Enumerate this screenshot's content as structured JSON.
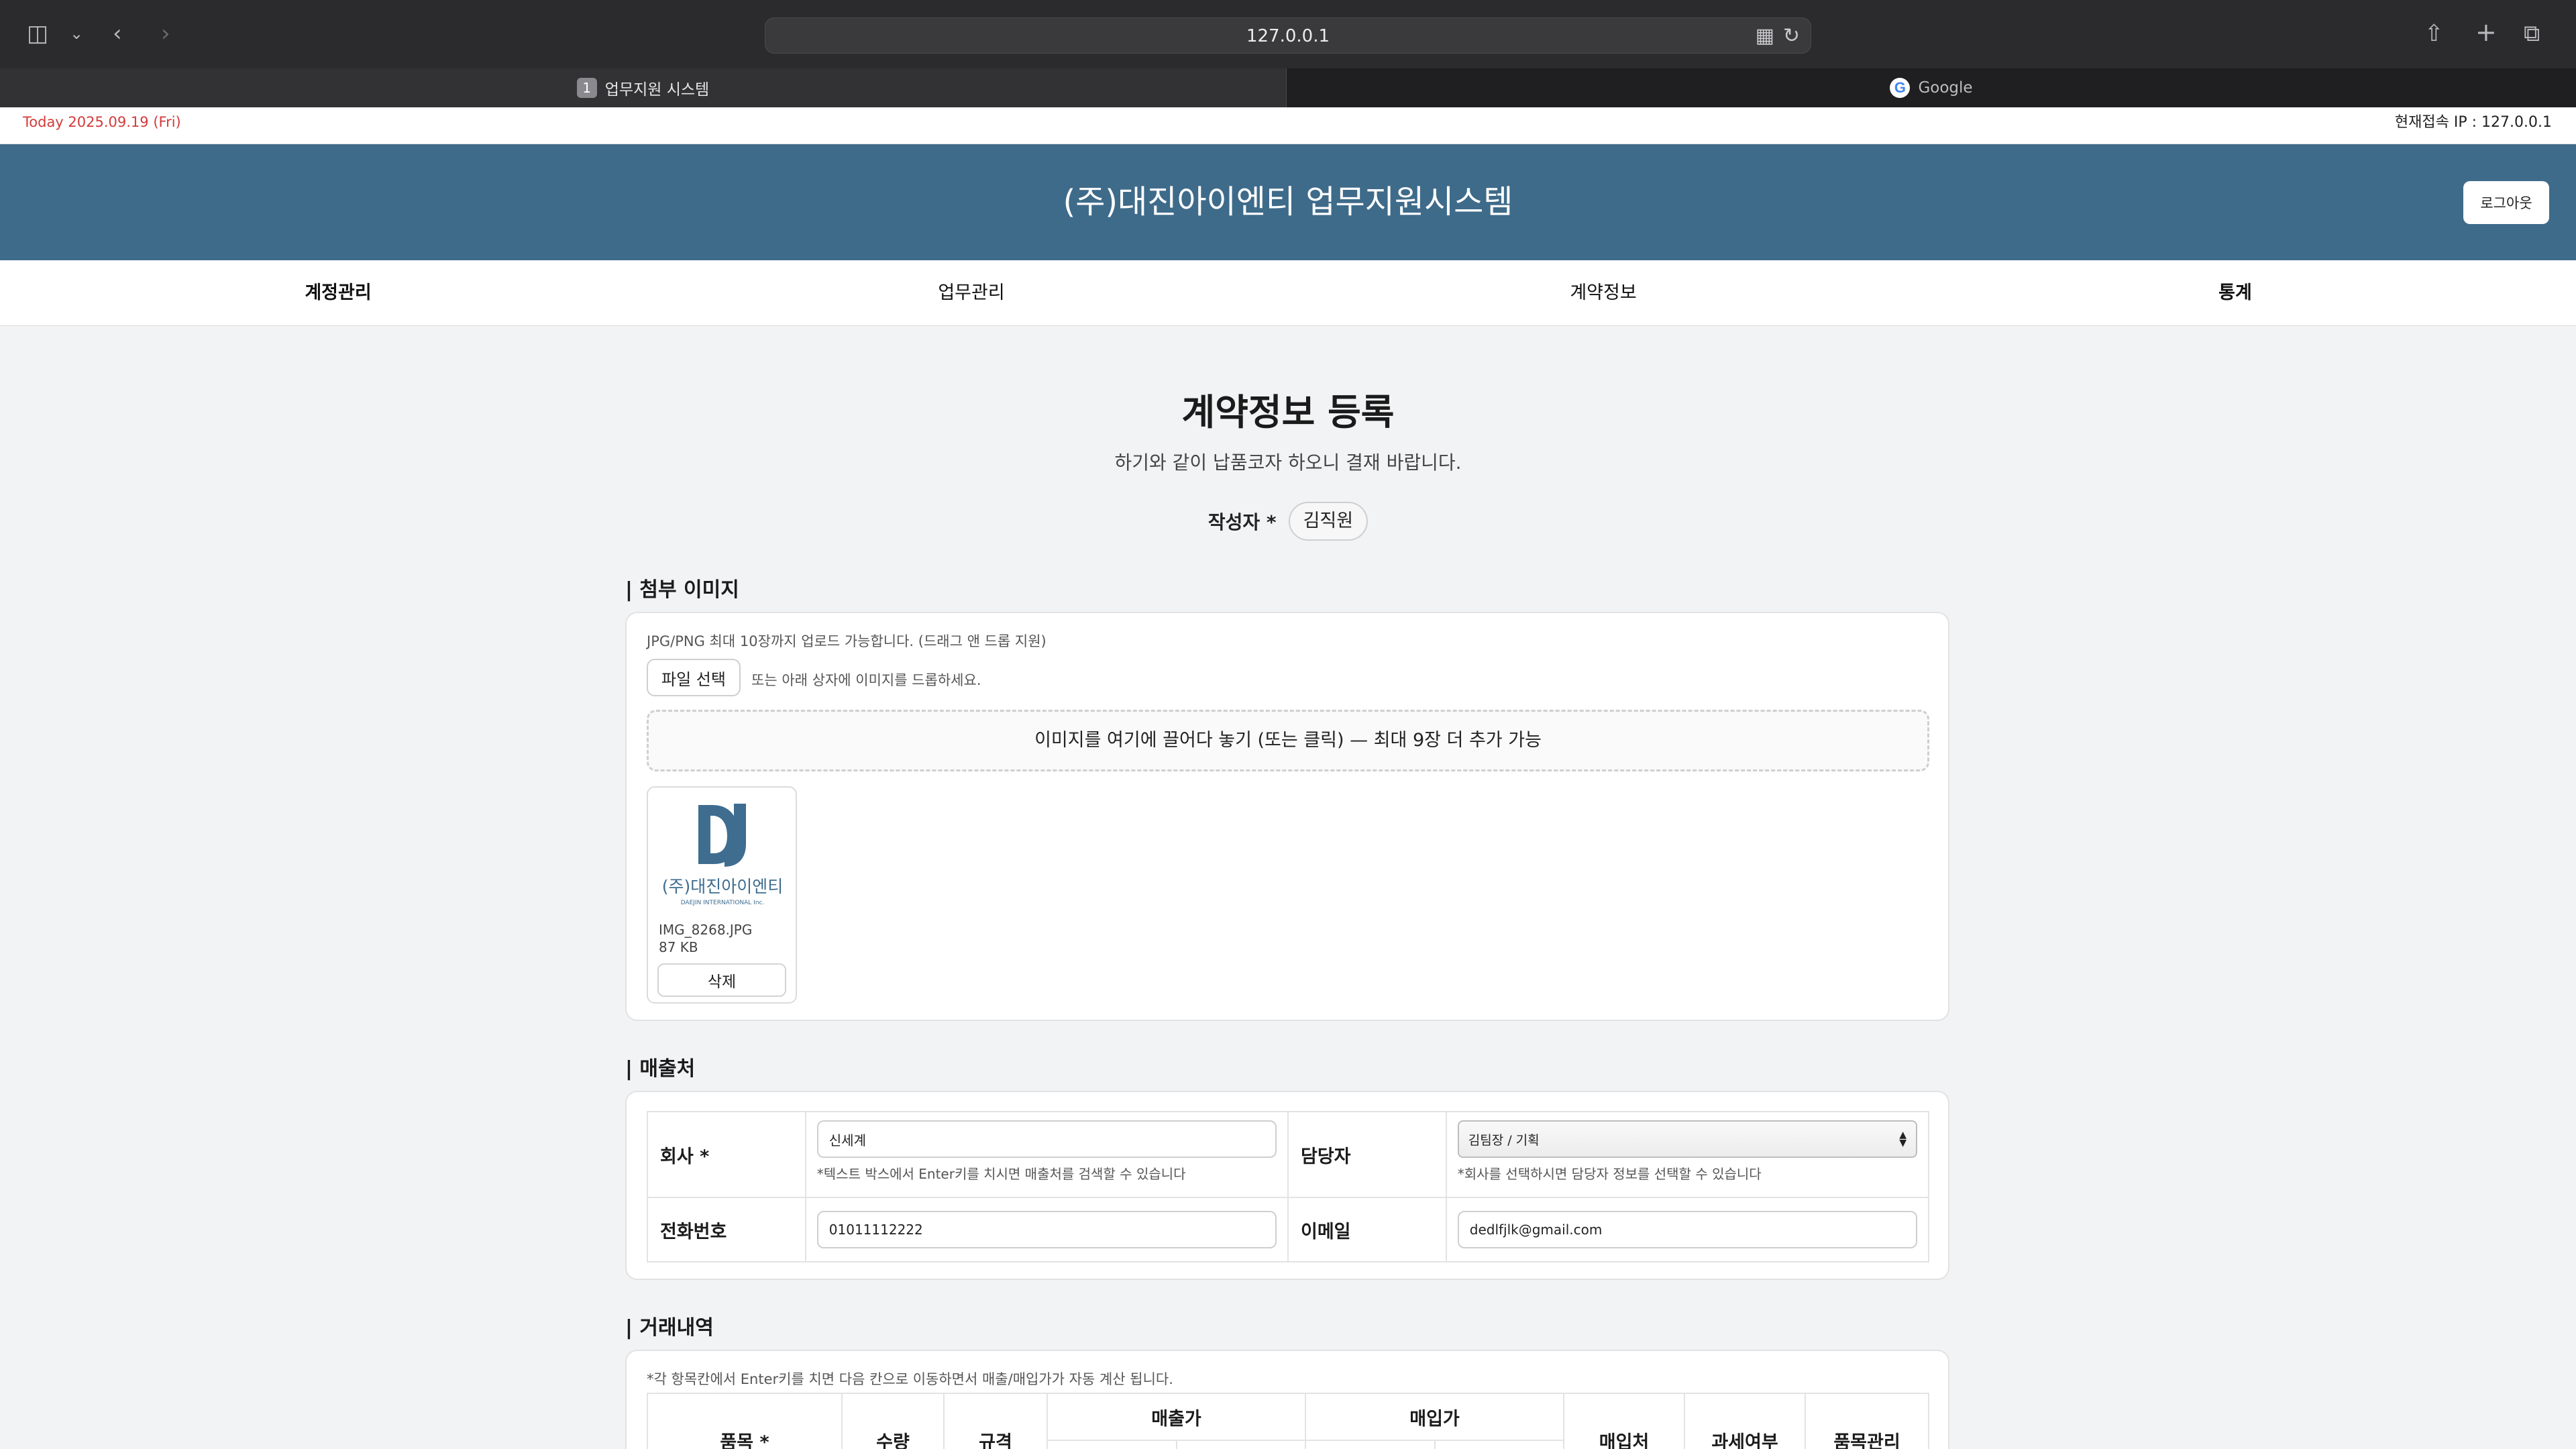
{
  "browser": {
    "url": "127.0.0.1",
    "tabs": [
      {
        "label": "업무지원 시스템",
        "badge": "1",
        "active": true
      },
      {
        "label": "Google",
        "active": false
      }
    ]
  },
  "info_bar": {
    "today": "Today 2025.09.19 (Fri)",
    "ip": "현재접속 IP : 127.0.0.1"
  },
  "header": {
    "title": "(주)대진아이엔티 업무지원시스템",
    "logout_label": "로그아웃"
  },
  "nav": {
    "items": [
      {
        "label": "계정관리",
        "bold": true
      },
      {
        "label": "업무관리",
        "bold": false
      },
      {
        "label": "계약정보",
        "bold": false
      },
      {
        "label": "통계",
        "bold": true
      }
    ]
  },
  "page": {
    "title": "계약정보 등록",
    "subtitle": "하기와 같이 납품코자 하오니 결재 바랍니다.",
    "author_label": "작성자 *",
    "author_value": "김직원"
  },
  "attachments": {
    "section_title": "| 첨부 이미지",
    "limit_hint": "JPG/PNG 최대 10장까지 업로드 가능합니다. (드래그 앤 드롭 지원)",
    "file_button_label": "파일 선택",
    "file_hint": "또는 아래 상자에 이미지를 드롭하세요.",
    "dropzone_text": "이미지를 여기에 끌어다 놓기 (또는 클릭) — 최대 9장 더 추가 가능",
    "files": [
      {
        "name": "IMG_8268.JPG",
        "size": "87 KB",
        "delete_label": "삭제",
        "logo_text": "(주)대진아이엔티",
        "logo_subtext": "DAEJIN INTERNATIONAL Inc.",
        "logo_color": "#3e6d90"
      }
    ]
  },
  "seller": {
    "section_title": "| 매출처",
    "company_label": "회사 *",
    "company_value": "신세계",
    "company_hint": "*텍스트 박스에서 Enter키를 치시면 매출처를 검색할 수 있습니다",
    "manager_label": "담당자",
    "manager_value": "김팀장 / 기획",
    "manager_hint": "*회사를 선택하시면 담당자 정보를 선택할 수 있습니다",
    "phone_label": "전화번호",
    "phone_value": "01011112222",
    "email_label": "이메일",
    "email_value": "dedlfjlk@gmail.com"
  },
  "trades": {
    "section_title": "| 거래내역",
    "hint": "*각 항목칸에서 Enter키를 치면 다음 칸으로 이동하면서 매출/매입가가 자동 계산 됩니다.",
    "headers": {
      "item": "품목 *",
      "qty": "수량",
      "spec": "규격",
      "sale_price": "매출가",
      "purchase_price": "매입가",
      "vendor": "매입처",
      "tax": "과세여부",
      "item_manage": "품목관리"
    }
  },
  "colors": {
    "header_bg": "#3f6b8a",
    "today_text": "#d33a3a"
  }
}
